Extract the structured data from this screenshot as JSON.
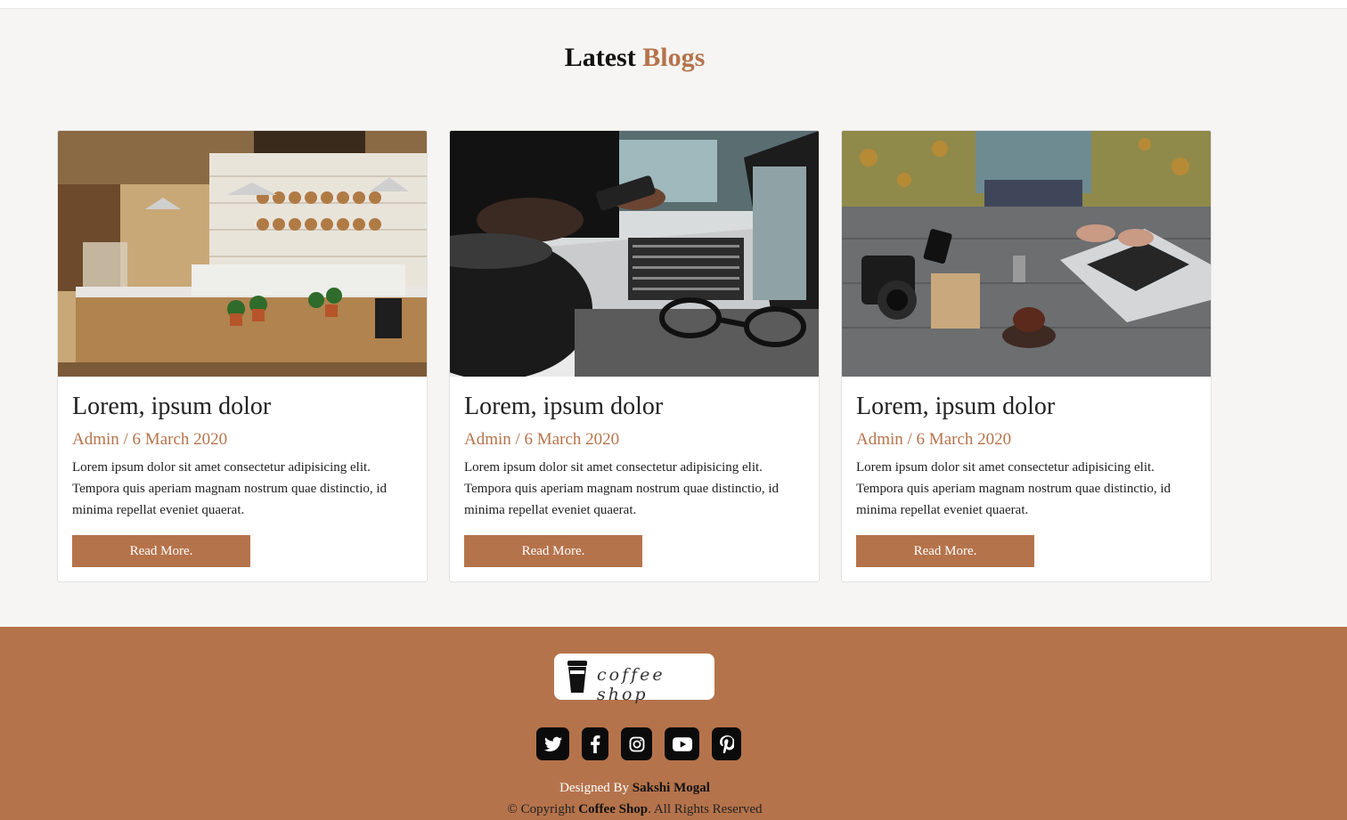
{
  "section": {
    "title_prefix": "Latest",
    "title_accent": "Blogs"
  },
  "blogs": [
    {
      "title": "Lorem, ipsum dolor",
      "meta": "Admin / 6 March 2020",
      "text": "Lorem ipsum dolor sit amet consectetur adipisicing elit. Tempora quis aperiam magnam nostrum quae distinctio, id minima repellat eveniet quaerat.",
      "button": "Read More.",
      "image": "cafe-interior-photo"
    },
    {
      "title": "Lorem, ipsum dolor",
      "meta": "Admin / 6 March 2020",
      "text": "Lorem ipsum dolor sit amet consectetur adipisicing elit. Tempora quis aperiam magnam nostrum quae distinctio, id minima repellat eveniet quaerat.",
      "button": "Read More.",
      "image": "laptop-phone-coffee-photo"
    },
    {
      "title": "Lorem, ipsum dolor",
      "meta": "Admin / 6 March 2020",
      "text": "Lorem ipsum dolor sit amet consectetur adipisicing elit. Tempora quis aperiam magnam nostrum quae distinctio, id minima repellat eveniet quaerat.",
      "button": "Read More.",
      "image": "desk-camera-laptop-photo"
    }
  ],
  "footer": {
    "logo_text": "coffee shop",
    "social": [
      "twitter-icon",
      "facebook-icon",
      "instagram-icon",
      "youtube-icon",
      "pinterest-icon"
    ],
    "designed_by_label": "Designed By",
    "designer_name": "Sakshi Mogal",
    "copyright_prefix": "© Copyright",
    "brand": "Coffee Shop",
    "copyright_suffix": ". All Rights Reserved"
  },
  "colors": {
    "accent": "#b5734b",
    "page_bg": "#f6f5f3",
    "social_bg": "#0b0b0b"
  }
}
